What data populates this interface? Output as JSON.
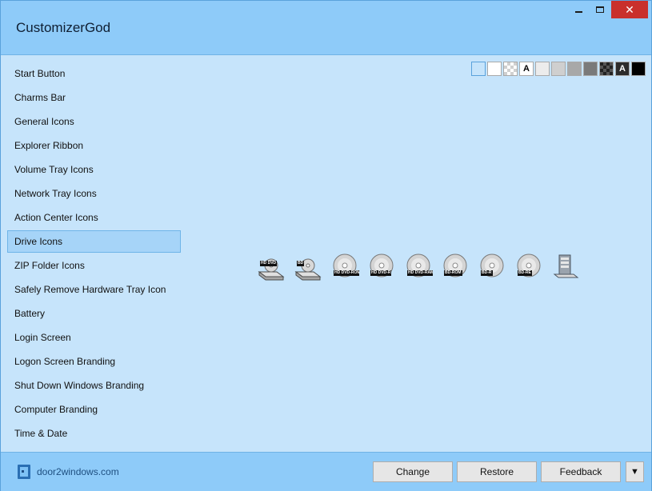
{
  "window": {
    "title": "CustomizerGod"
  },
  "window_controls": {
    "minimize": "minimize",
    "maximize": "maximize",
    "close": "✕"
  },
  "sidebar": {
    "items": [
      {
        "label": "Start Button"
      },
      {
        "label": "Charms Bar"
      },
      {
        "label": "General Icons"
      },
      {
        "label": "Explorer Ribbon"
      },
      {
        "label": "Volume Tray Icons"
      },
      {
        "label": "Network Tray Icons"
      },
      {
        "label": "Action Center Icons"
      },
      {
        "label": "Drive Icons",
        "selected": true
      },
      {
        "label": "ZIP Folder Icons"
      },
      {
        "label": "Safely Remove Hardware Tray Icon"
      },
      {
        "label": "Battery"
      },
      {
        "label": "Login Screen"
      },
      {
        "label": "Logon Screen Branding"
      },
      {
        "label": "Shut Down Windows Branding"
      },
      {
        "label": "Computer Branding"
      },
      {
        "label": "Time & Date"
      }
    ]
  },
  "background_swatches": [
    {
      "name": "light-blue",
      "color": "#c6e4fb",
      "selected": true
    },
    {
      "name": "white",
      "color": "#ffffff"
    },
    {
      "name": "checker",
      "color": "#ffffff"
    },
    {
      "name": "white-text-sample",
      "color": "#ffffff",
      "text": "A",
      "text_color": "#000000"
    },
    {
      "name": "light-gray-1",
      "color": "#ececec"
    },
    {
      "name": "light-gray-2",
      "color": "#cfcfcf"
    },
    {
      "name": "gray",
      "color": "#a8a8a8"
    },
    {
      "name": "dark-gray",
      "color": "#7a7a7a"
    },
    {
      "name": "checker-dark",
      "color": "#333333"
    },
    {
      "name": "dark-text-sample",
      "color": "#2b2b2b",
      "text": "A",
      "text_color": "#ffffff"
    },
    {
      "name": "black",
      "color": "#000000"
    }
  ],
  "drive_icons": [
    {
      "name": "hddvd-drive",
      "label": "HD DVD"
    },
    {
      "name": "bd-drive",
      "label": "BD"
    },
    {
      "name": "hddvd-rom-disc",
      "label": "HD DVD-ROM"
    },
    {
      "name": "hddvd-r-disc",
      "label": "HD DVD-R"
    },
    {
      "name": "hddvd-ram-disc",
      "label": "HD DVD-RAM"
    },
    {
      "name": "bd-rom-disc",
      "label": "BD-ROM"
    },
    {
      "name": "bd-r-disc",
      "label": "BD-R"
    },
    {
      "name": "bd-re-disc",
      "label": "BD-RE"
    },
    {
      "name": "server-drive",
      "label": ""
    }
  ],
  "footer": {
    "brand_link": "door2windows.com",
    "change_label": "Change",
    "restore_label": "Restore",
    "feedback_label": "Feedback",
    "more_label": "▼"
  },
  "colors": {
    "titlebar": "#8ecbf9",
    "body": "#c6e4fb",
    "selection": "#a6d4f8",
    "close": "#c9302c"
  }
}
